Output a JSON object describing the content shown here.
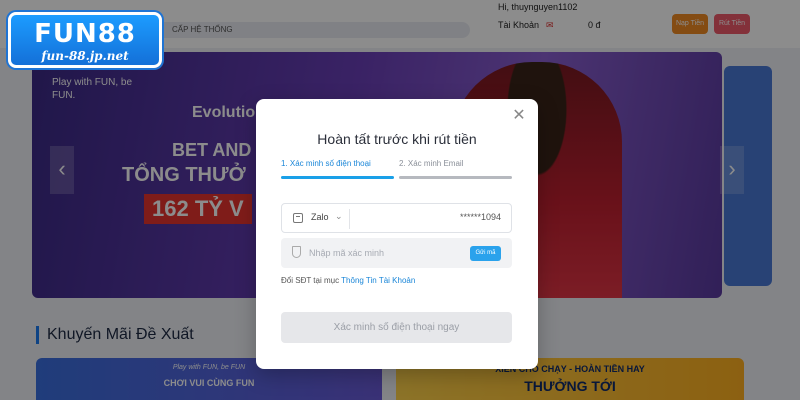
{
  "brand": {
    "logo_main": "FUN88",
    "logo_sub": "fun-88.jp.net"
  },
  "header": {
    "greeting": "Hi, thuynguyen1102",
    "notice": "CẤP HỆ THỐNG",
    "account_label": "Tài Khoản",
    "balance": "0 đ",
    "deposit_label": "Nạp Tiền",
    "withdraw_label": "Rút Tiền"
  },
  "banner": {
    "tagline": "Play with FUN, be FUN.",
    "brand": "Evolutio",
    "headline_1": "BET AND",
    "headline_2": "TỔNG THƯỞ",
    "amount": "162 TỶ V"
  },
  "promotions": {
    "section_title": "Khuyến Mãi Đề Xuất",
    "card_1_tag": "Play with FUN, be FUN",
    "card_1_text": "CHƠI VUI CÙNG FUN",
    "card_2_text": "XIÊN CHO CHẠY - HOÀN TIỀN HAY",
    "card_2_sub": "THƯỞNG TỚI"
  },
  "modal": {
    "title": "Hoàn tất trước khi rút tiền",
    "close_glyph": "✕",
    "steps": [
      {
        "label": "1. Xác minh số điện thoại",
        "active": true
      },
      {
        "label": "2. Xác minh Email",
        "active": false
      }
    ],
    "phone": {
      "app_label": "Zalo",
      "chevron": "⌄",
      "masked_number": "******1094"
    },
    "code": {
      "value": "",
      "placeholder": "Nhập mã xác minh",
      "send_label": "Gửi mã"
    },
    "hint_text": "Đổi SĐT tại mục ",
    "hint_link": "Thông Tin Tài Khoản",
    "submit_label": "Xác minh số điện thoại ngay",
    "colors": {
      "accent": "#1aa0e8",
      "link": "#1a86d8",
      "disabled_bg": "#e6e7ea"
    }
  },
  "icons": [
    "close-icon",
    "chat-app-icon",
    "chevron-down-icon",
    "shield-icon",
    "chevron-left-icon",
    "chevron-right-icon"
  ]
}
